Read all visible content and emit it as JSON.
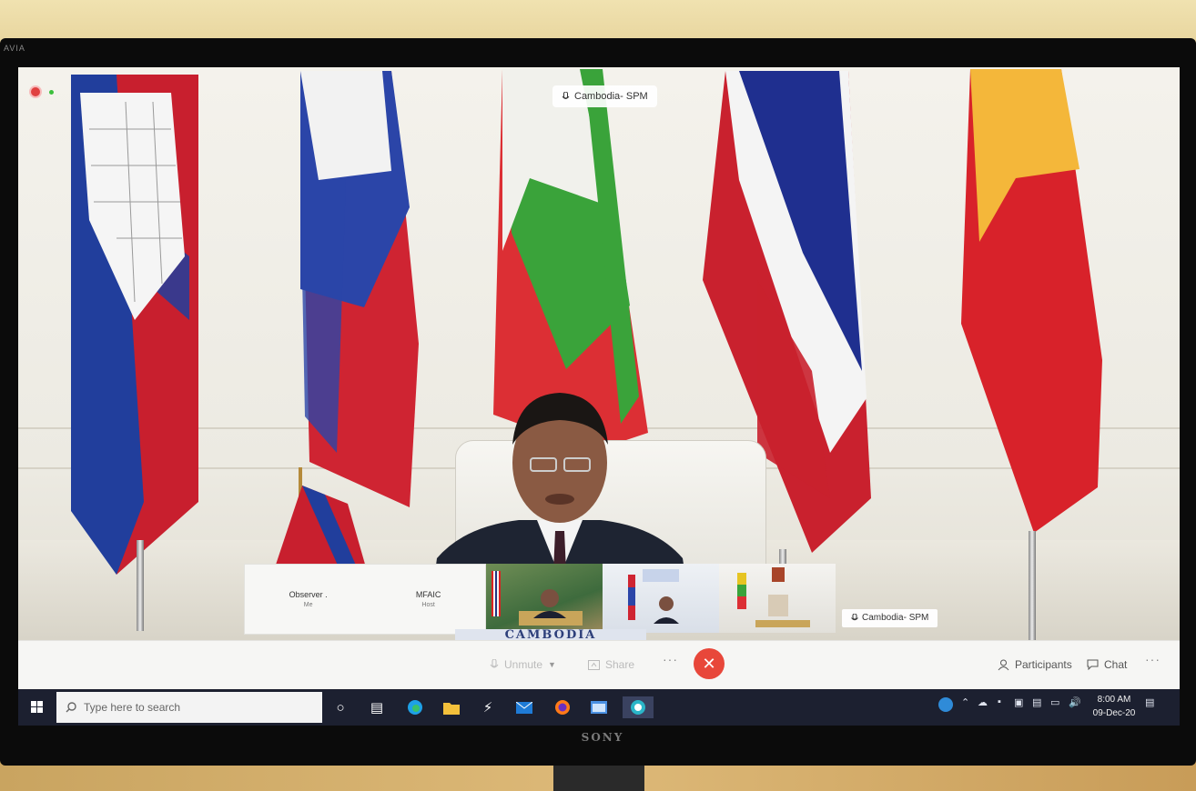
{
  "monitor": {
    "corner_text": "AVIA",
    "brand": "SONY"
  },
  "meeting": {
    "active_speaker_label": "Cambodia- SPM",
    "participants_strip": [
      {
        "name": "Observer .",
        "role": "Me"
      },
      {
        "name": "MFAIC",
        "role": "Host"
      }
    ],
    "active_tile_label": "Cambodia- SPM",
    "banner_text": "CAMBODIA",
    "controls": {
      "unmute": "Unmute",
      "share": "Share",
      "more": "···",
      "participants": "Participants",
      "chat": "Chat",
      "right_more": "···"
    }
  },
  "taskbar": {
    "search_placeholder": "Type here to search",
    "time": "8:00 AM",
    "date": "09-Dec-20"
  },
  "icons": {
    "record": "record-icon",
    "mic": "mic-icon",
    "share": "share-icon",
    "hangup": "hangup-icon",
    "participants": "participants-icon",
    "chat": "chat-icon",
    "windows": "windows-icon"
  },
  "colors": {
    "hangup": "#e8473a",
    "taskbar": "#1c2030",
    "screen_bg": "#f4f3ee"
  }
}
